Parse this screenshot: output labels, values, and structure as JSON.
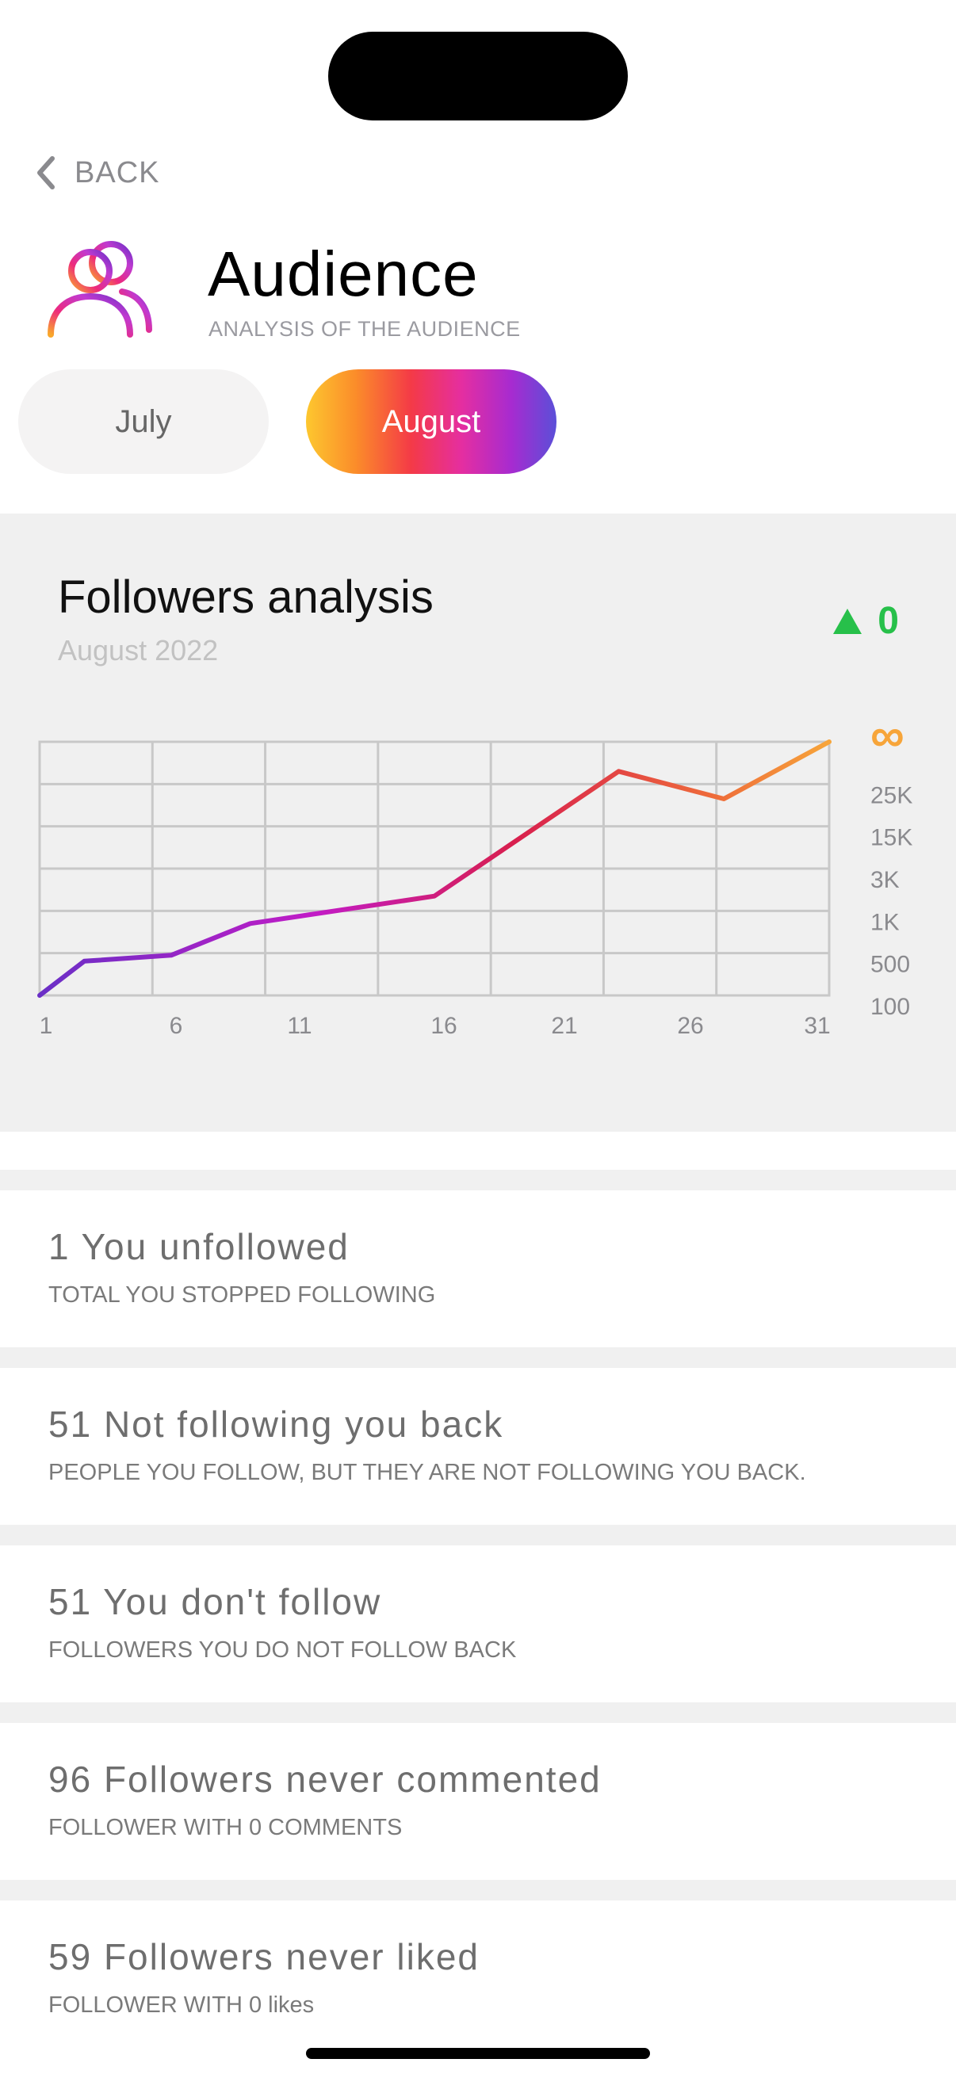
{
  "header": {
    "back_label": "BACK",
    "title": "Audience",
    "subtitle": "ANALYSIS OF THE AUDIENCE"
  },
  "months": [
    {
      "label": "July",
      "selected": false
    },
    {
      "label": "August",
      "selected": true
    }
  ],
  "followers_analysis": {
    "title": "Followers analysis",
    "subtitle": "August 2022",
    "change_value": "0",
    "change_color": "#27c04a"
  },
  "chart_data": {
    "type": "line",
    "x_ticks": [
      "1",
      "6",
      "11",
      "16",
      "21",
      "26",
      "31"
    ],
    "y_ticks": [
      "∞",
      "25K",
      "15K",
      "3K",
      "1K",
      "500",
      "100"
    ],
    "y_scale": "ordinal (non-linear labels)",
    "x": [
      1,
      2.7,
      6,
      9,
      16,
      23,
      27,
      31
    ],
    "y_level": [
      0,
      0.81,
      0.95,
      1.7,
      2.35,
      5.3,
      4.65,
      6
    ],
    "colors": {
      "start": "#6a2fc6",
      "mid": "#d81f6e",
      "end": "#f7a53a",
      "infinity": "#f7a53a"
    },
    "grid": true
  },
  "stats": [
    {
      "title": "1 You unfollowed",
      "desc": "TOTAL YOU STOPPED FOLLOWING"
    },
    {
      "title": "51 Not following you back",
      "desc": "PEOPLE YOU FOLLOW, BUT THEY ARE NOT FOLLOWING YOU BACK."
    },
    {
      "title": "51 You don't follow",
      "desc": "FOLLOWERS YOU DO NOT FOLLOW BACK"
    },
    {
      "title": "96 Followers never commented",
      "desc": "FOLLOWER WITH 0 COMMENTS"
    },
    {
      "title": "59 Followers never liked",
      "desc": "FOLLOWER WITH 0 likes"
    }
  ]
}
